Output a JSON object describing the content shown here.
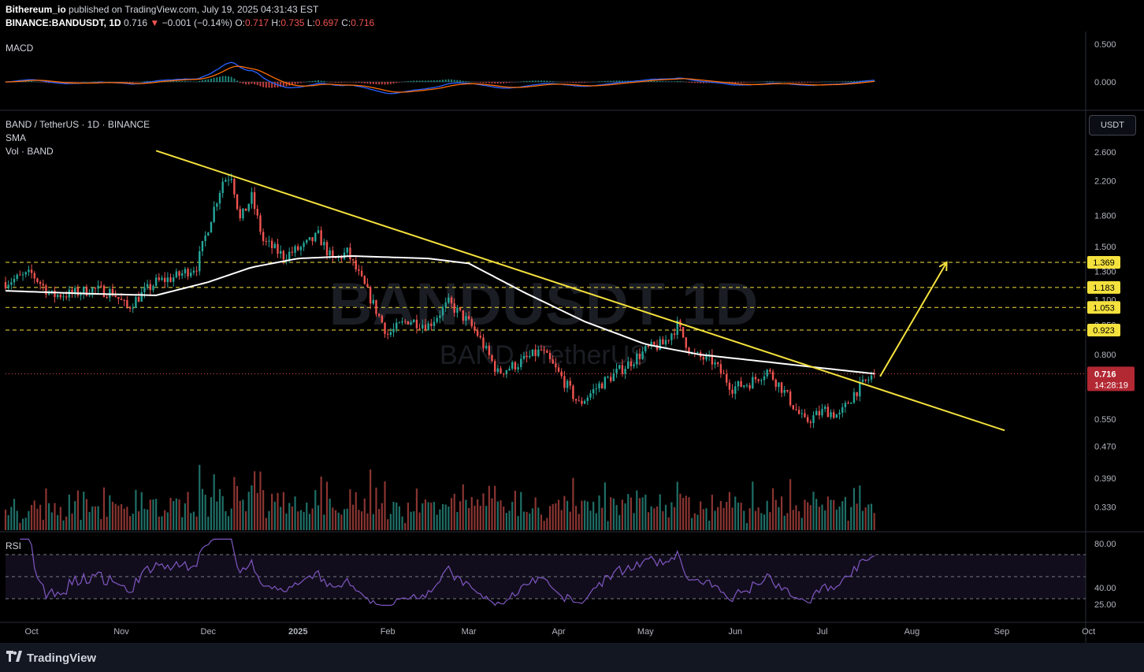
{
  "header": {
    "publisher": "Bithereum_io",
    "published_text": "published on TradingView.com, July 19, 2025 04:31:43 EST",
    "symbol": "BINANCE:BANDUSDT, 1D",
    "last": "0.716",
    "change": "−0.001 (−0.14%)",
    "o_label": "O:",
    "o": "0.717",
    "h_label": "H:",
    "h": "0.735",
    "l_label": "L:",
    "l": "0.697",
    "c_label": "C:",
    "c": "0.716"
  },
  "legend": {
    "main": "BAND / TetherUS · 1D · BINANCE",
    "sma": "SMA",
    "vol": "Vol · BAND",
    "macd": "MACD",
    "rsi": "RSI"
  },
  "watermark": {
    "line1": "BANDUSDT, 1D",
    "line2": "BAND / TetherUS"
  },
  "currency_button": "USDT",
  "price_tag": {
    "value": "0.716",
    "countdown": "14:28:19"
  },
  "footer": {
    "brand": "TradingView"
  },
  "colors": {
    "up": "#26a69a",
    "down": "#ef5350",
    "trend": "#f5e13d",
    "sma": "#ffffff",
    "rsi": "#7e57c2",
    "macd": "#2962ff",
    "signal": "#ff6d00"
  },
  "chart_data": [
    {
      "type": "candlestick",
      "title": "BAND / TetherUS · 1D · BINANCE",
      "scale": "log",
      "y_ticks": [
        "2.600",
        "2.200",
        "1.800",
        "1.500",
        "1.300",
        "1.100",
        "0.950",
        "0.800",
        "0.690",
        "0.550",
        "0.470",
        "0.390",
        "0.330"
      ],
      "ylim": [
        0.3,
        2.9
      ],
      "x_ticks": [
        "Oct",
        "Nov",
        "Dec",
        "2025",
        "Feb",
        "Mar",
        "Apr",
        "May",
        "Jun",
        "Jul",
        "Aug",
        "Sep",
        "Oct"
      ],
      "close_path": [
        [
          "2024-09-22",
          1.22
        ],
        [
          "2024-10-01",
          1.28
        ],
        [
          "2024-10-08",
          1.13
        ],
        [
          "2024-10-15",
          1.14
        ],
        [
          "2024-10-22",
          1.17
        ],
        [
          "2024-10-29",
          1.15
        ],
        [
          "2024-11-03",
          1.05
        ],
        [
          "2024-11-07",
          1.12
        ],
        [
          "2024-11-13",
          1.22
        ],
        [
          "2024-11-20",
          1.26
        ],
        [
          "2024-11-27",
          1.34
        ],
        [
          "2024-12-02",
          1.78
        ],
        [
          "2024-12-06",
          2.2
        ],
        [
          "2024-12-09",
          2.28
        ],
        [
          "2024-12-12",
          1.75
        ],
        [
          "2024-12-16",
          2.0
        ],
        [
          "2024-12-20",
          1.55
        ],
        [
          "2024-12-27",
          1.42
        ],
        [
          "2025-01-03",
          1.5
        ],
        [
          "2025-01-08",
          1.6
        ],
        [
          "2025-01-13",
          1.38
        ],
        [
          "2025-01-18",
          1.45
        ],
        [
          "2025-01-25",
          1.15
        ],
        [
          "2025-02-01",
          0.9
        ],
        [
          "2025-02-08",
          0.98
        ],
        [
          "2025-02-15",
          0.95
        ],
        [
          "2025-02-22",
          1.08
        ],
        [
          "2025-02-28",
          0.98
        ],
        [
          "2025-03-04",
          0.9
        ],
        [
          "2025-03-11",
          0.72
        ],
        [
          "2025-03-18",
          0.76
        ],
        [
          "2025-03-26",
          0.82
        ],
        [
          "2025-04-02",
          0.7
        ],
        [
          "2025-04-08",
          0.6
        ],
        [
          "2025-04-15",
          0.67
        ],
        [
          "2025-04-22",
          0.73
        ],
        [
          "2025-05-02",
          0.83
        ],
        [
          "2025-05-07",
          0.85
        ],
        [
          "2025-05-12",
          0.95
        ],
        [
          "2025-05-17",
          0.8
        ],
        [
          "2025-05-24",
          0.77
        ],
        [
          "2025-05-31",
          0.66
        ],
        [
          "2025-06-06",
          0.68
        ],
        [
          "2025-06-12",
          0.73
        ],
        [
          "2025-06-17",
          0.66
        ],
        [
          "2025-06-22",
          0.58
        ],
        [
          "2025-06-25",
          0.54
        ],
        [
          "2025-07-02",
          0.58
        ],
        [
          "2025-07-07",
          0.56
        ],
        [
          "2025-07-12",
          0.64
        ],
        [
          "2025-07-19",
          0.716
        ]
      ],
      "sma_path": [
        [
          "2024-09-22",
          1.16
        ],
        [
          "2024-10-22",
          1.14
        ],
        [
          "2024-11-13",
          1.13
        ],
        [
          "2024-12-01",
          1.22
        ],
        [
          "2024-12-16",
          1.33
        ],
        [
          "2025-01-01",
          1.4
        ],
        [
          "2025-01-20",
          1.42
        ],
        [
          "2025-02-15",
          1.4
        ],
        [
          "2025-03-01",
          1.36
        ],
        [
          "2025-03-20",
          1.15
        ],
        [
          "2025-04-10",
          0.97
        ],
        [
          "2025-05-01",
          0.85
        ],
        [
          "2025-05-20",
          0.8
        ],
        [
          "2025-06-10",
          0.77
        ],
        [
          "2025-07-01",
          0.74
        ],
        [
          "2025-07-19",
          0.716
        ]
      ],
      "horizontal_levels": [
        "1.369",
        "1.183",
        "1.053",
        "0.923"
      ],
      "current_price": "0.716",
      "annotations": [
        {
          "type": "descending_trendline",
          "from": [
            "2024-11-13",
            2.62
          ],
          "to": [
            "2025-09-02",
            0.515
          ]
        },
        {
          "type": "arrow",
          "from": [
            "2025-07-21",
            0.705
          ],
          "to": [
            "2025-08-13",
            1.369
          ]
        }
      ]
    },
    {
      "type": "bar",
      "title": "Vol · BAND",
      "notes": "daily volume bars, colored by candle direction"
    },
    {
      "type": "line",
      "title": "MACD",
      "y_ticks": [
        "0.500",
        "0.000"
      ],
      "ylim": [
        -0.12,
        0.62
      ]
    },
    {
      "type": "line",
      "title": "RSI",
      "y_ticks": [
        "80.00",
        "40.00",
        "25.00"
      ],
      "ylim": [
        22,
        84
      ],
      "bands": [
        70,
        50,
        30
      ]
    }
  ]
}
